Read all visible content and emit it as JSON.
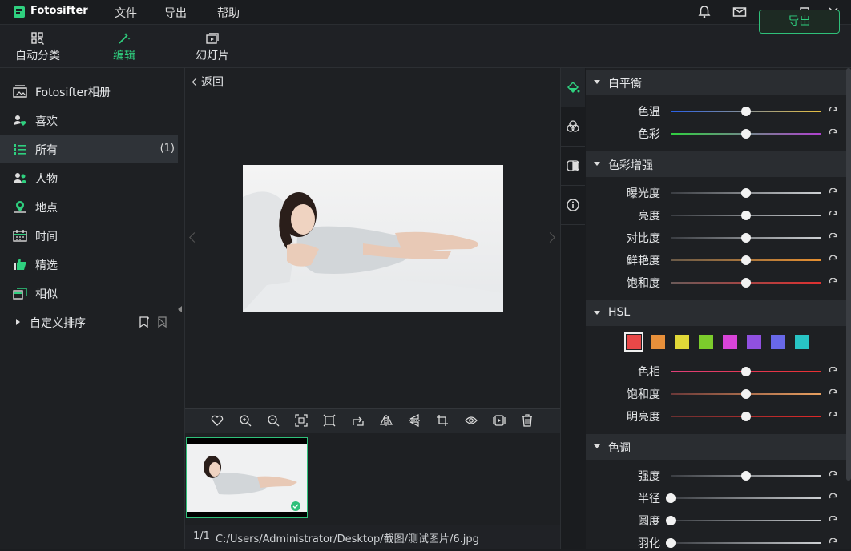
{
  "app": {
    "name": "Fotosifter"
  },
  "menu": {
    "file": "文件",
    "export": "导出",
    "help": "帮助"
  },
  "toolbar": {
    "auto_classify": "自动分类",
    "edit": "编辑",
    "slideshow": "幻灯片",
    "export_button": "导出"
  },
  "sidebar": {
    "items": [
      {
        "label": "Fotosifter相册",
        "icon": "album-icon"
      },
      {
        "label": "喜欢",
        "icon": "heart-user-icon"
      },
      {
        "label": "所有",
        "icon": "list-icon",
        "count": "(1)"
      },
      {
        "label": "人物",
        "icon": "people-icon"
      },
      {
        "label": "地点",
        "icon": "location-icon"
      },
      {
        "label": "时间",
        "icon": "calendar-icon"
      },
      {
        "label": "精选",
        "icon": "thumbs-up-icon"
      },
      {
        "label": "相似",
        "icon": "similar-icon"
      }
    ],
    "custom_sort": "自定义排序"
  },
  "viewer": {
    "back": "返回"
  },
  "status": {
    "position": "1/1",
    "path": "C:/Users/Administrator/Desktop/截图/测试图片/6.jpg"
  },
  "panel": {
    "white_balance": {
      "title": "白平衡",
      "temp": "色温",
      "tint": "色彩"
    },
    "color_enhance": {
      "title": "色彩增强",
      "exposure": "曝光度",
      "brightness": "亮度",
      "contrast": "对比度",
      "vibrance": "鲜艳度",
      "saturation": "饱和度"
    },
    "hsl": {
      "title": "HSL",
      "hue": "色相",
      "saturation": "饱和度",
      "lightness": "明亮度",
      "swatches": [
        "#e84848",
        "#e8903a",
        "#e0d838",
        "#7ccc2c",
        "#d844d8",
        "#9050e0",
        "#6868e8",
        "#28c4c4"
      ]
    },
    "tone": {
      "title": "色调",
      "strength": "强度",
      "radius": "半径",
      "roundness": "圆度",
      "feather": "羽化"
    }
  },
  "sliders": {
    "temp": 0.5,
    "tint": 0.5,
    "exposure": 0.5,
    "brightness": 0.5,
    "contrast": 0.5,
    "vibrance": 0.5,
    "saturation": 0.5,
    "hue": 0.5,
    "hsl_saturation": 0.5,
    "lightness": 0.5,
    "strength": 0.5,
    "radius": 0.0,
    "roundness": 0.0,
    "feather": 0.0
  },
  "colors": {
    "accent": "#2fd07f",
    "bg": "#1e2023"
  }
}
